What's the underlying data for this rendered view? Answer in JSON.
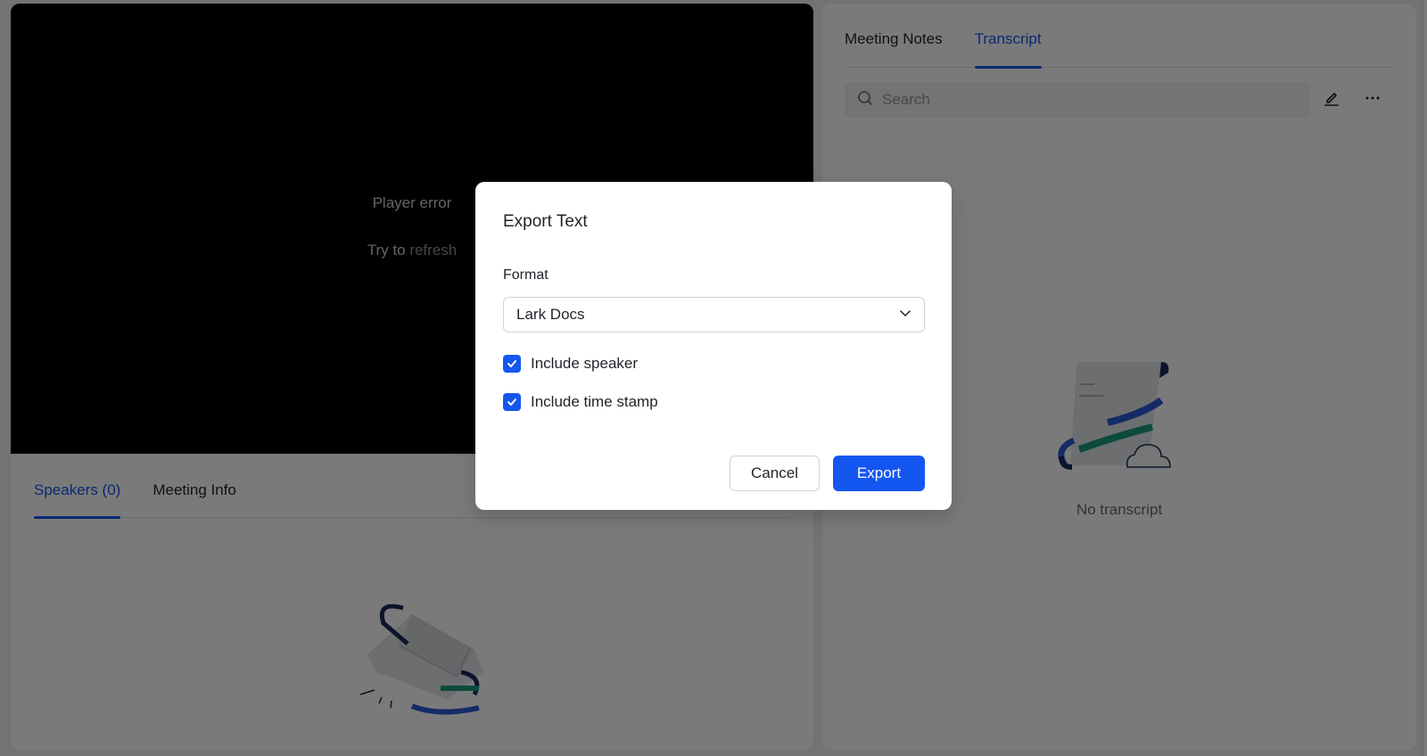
{
  "player": {
    "error_text": "Player error",
    "retry_prefix": "Try to",
    "retry_link": "refresh"
  },
  "left_panel": {
    "tabs": [
      {
        "label": "Speakers (0)",
        "active": true
      },
      {
        "label": "Meeting Info",
        "active": false
      }
    ],
    "empty_illustration": "empty-box-illustration"
  },
  "right_panel": {
    "tabs": [
      {
        "label": "Meeting Notes",
        "active": false
      },
      {
        "label": "Transcript",
        "active": true
      }
    ],
    "search": {
      "placeholder": "Search",
      "value": ""
    },
    "actions": {
      "edit_icon": "pencil-icon",
      "more_icon": "more-horizontal-icon"
    },
    "empty_illustration": "document-scroll-illustration",
    "empty_text": "No transcript"
  },
  "modal": {
    "title": "Export Text",
    "format_label": "Format",
    "format_value": "Lark Docs",
    "options": [
      {
        "label": "Include speaker",
        "checked": true
      },
      {
        "label": "Include time stamp",
        "checked": true
      }
    ],
    "cancel_label": "Cancel",
    "export_label": "Export"
  },
  "colors": {
    "accent": "#1456f0",
    "text": "#1f2329",
    "muted": "#8f959e",
    "illustration_blue": "#2c5bd8",
    "illustration_green": "#1b9e7e",
    "illustration_navy": "#1a2a5c"
  }
}
